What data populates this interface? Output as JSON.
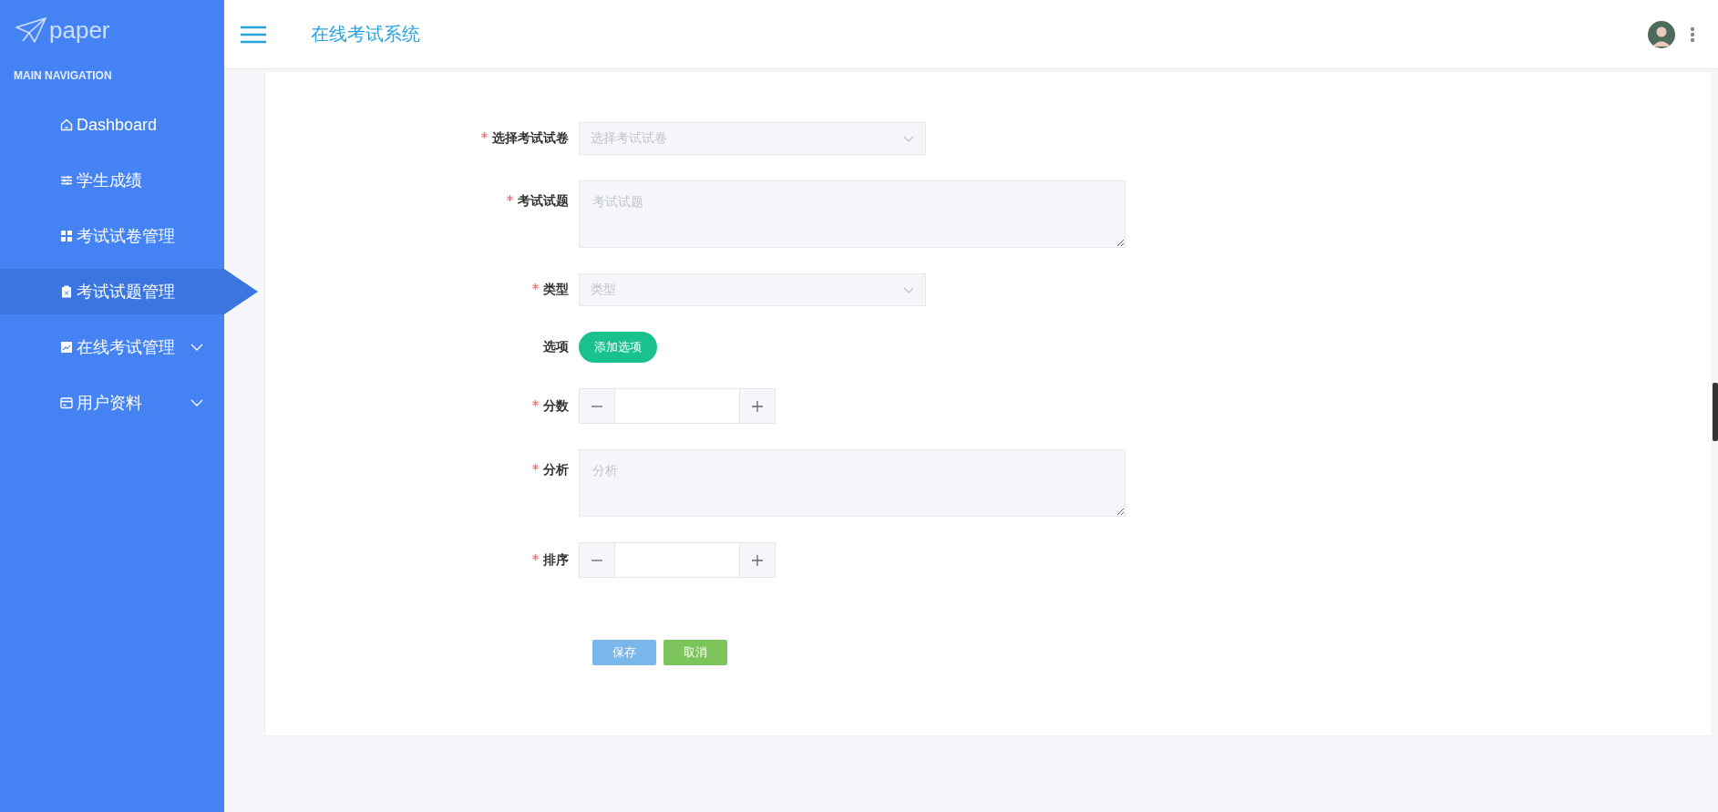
{
  "sidebar": {
    "logo": "paper",
    "section_title": "MAIN NAVIGATION",
    "items": [
      {
        "label": "Dashboard",
        "selected": false,
        "expandable": false
      },
      {
        "label": "学生成绩",
        "selected": false,
        "expandable": false
      },
      {
        "label": "考试试卷管理",
        "selected": false,
        "expandable": false
      },
      {
        "label": "考试试题管理",
        "selected": true,
        "expandable": false
      },
      {
        "label": "在线考试管理",
        "selected": false,
        "expandable": true
      },
      {
        "label": "用户资料",
        "selected": false,
        "expandable": true
      }
    ]
  },
  "header": {
    "title": "在线考试系统"
  },
  "form": {
    "fields": [
      {
        "kind": "select",
        "label": "选择考试试卷",
        "required": true,
        "placeholder": "选择考试试卷"
      },
      {
        "kind": "textarea",
        "label": "考试试题",
        "required": true,
        "placeholder": "考试试题"
      },
      {
        "kind": "select",
        "label": "类型",
        "required": true,
        "placeholder": "类型"
      },
      {
        "kind": "button",
        "label": "选项",
        "required": false,
        "button": "添加选项"
      },
      {
        "kind": "number",
        "label": "分数",
        "required": true
      },
      {
        "kind": "textarea",
        "label": "分析",
        "required": true,
        "placeholder": "分析"
      },
      {
        "kind": "number",
        "label": "排序",
        "required": true
      }
    ],
    "actions": [
      {
        "kind": "primary",
        "label": "保存"
      },
      {
        "kind": "success",
        "label": "取消"
      }
    ]
  }
}
